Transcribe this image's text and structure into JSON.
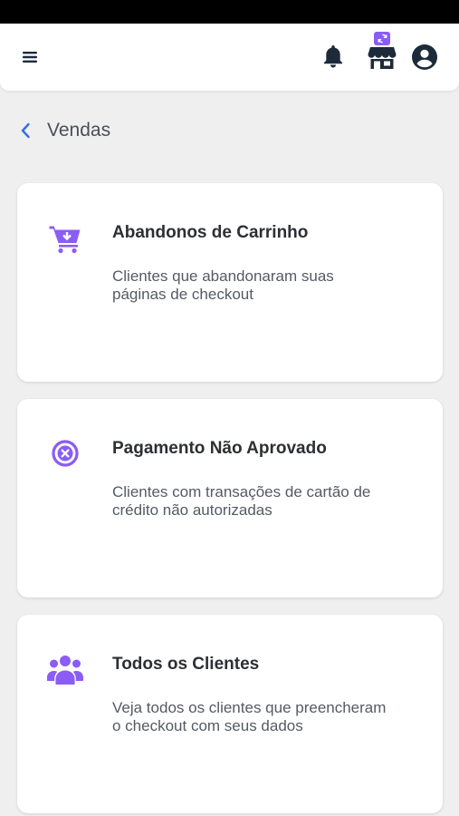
{
  "header": {
    "menu_icon": "hamburger-menu-icon",
    "notification_icon": "bell-icon",
    "store_icon": "storefront-icon",
    "store_badge_icon": "sync-icon",
    "account_icon": "account-circle-icon"
  },
  "breadcrumb": {
    "back_icon": "chevron-left-icon",
    "title": "Vendas"
  },
  "cards": [
    {
      "icon": "cart-download-icon",
      "title": "Abandonos de Carrinho",
      "description": "Clientes que abandonaram suas páginas de checkout"
    },
    {
      "icon": "close-circle-icon",
      "title": "Pagamento Não Aprovado",
      "description": "Clientes com transações de cartão de crédito não autorizadas"
    },
    {
      "icon": "users-group-icon",
      "title": "Todos os Clientes",
      "description": "Veja todos os clientes que preencheram o checkout com seus dados"
    }
  ],
  "colors": {
    "accent": "#8b5cf6",
    "back_arrow": "#2f6fe4",
    "dark_icon": "#1c2a3a",
    "background": "#efefef"
  }
}
